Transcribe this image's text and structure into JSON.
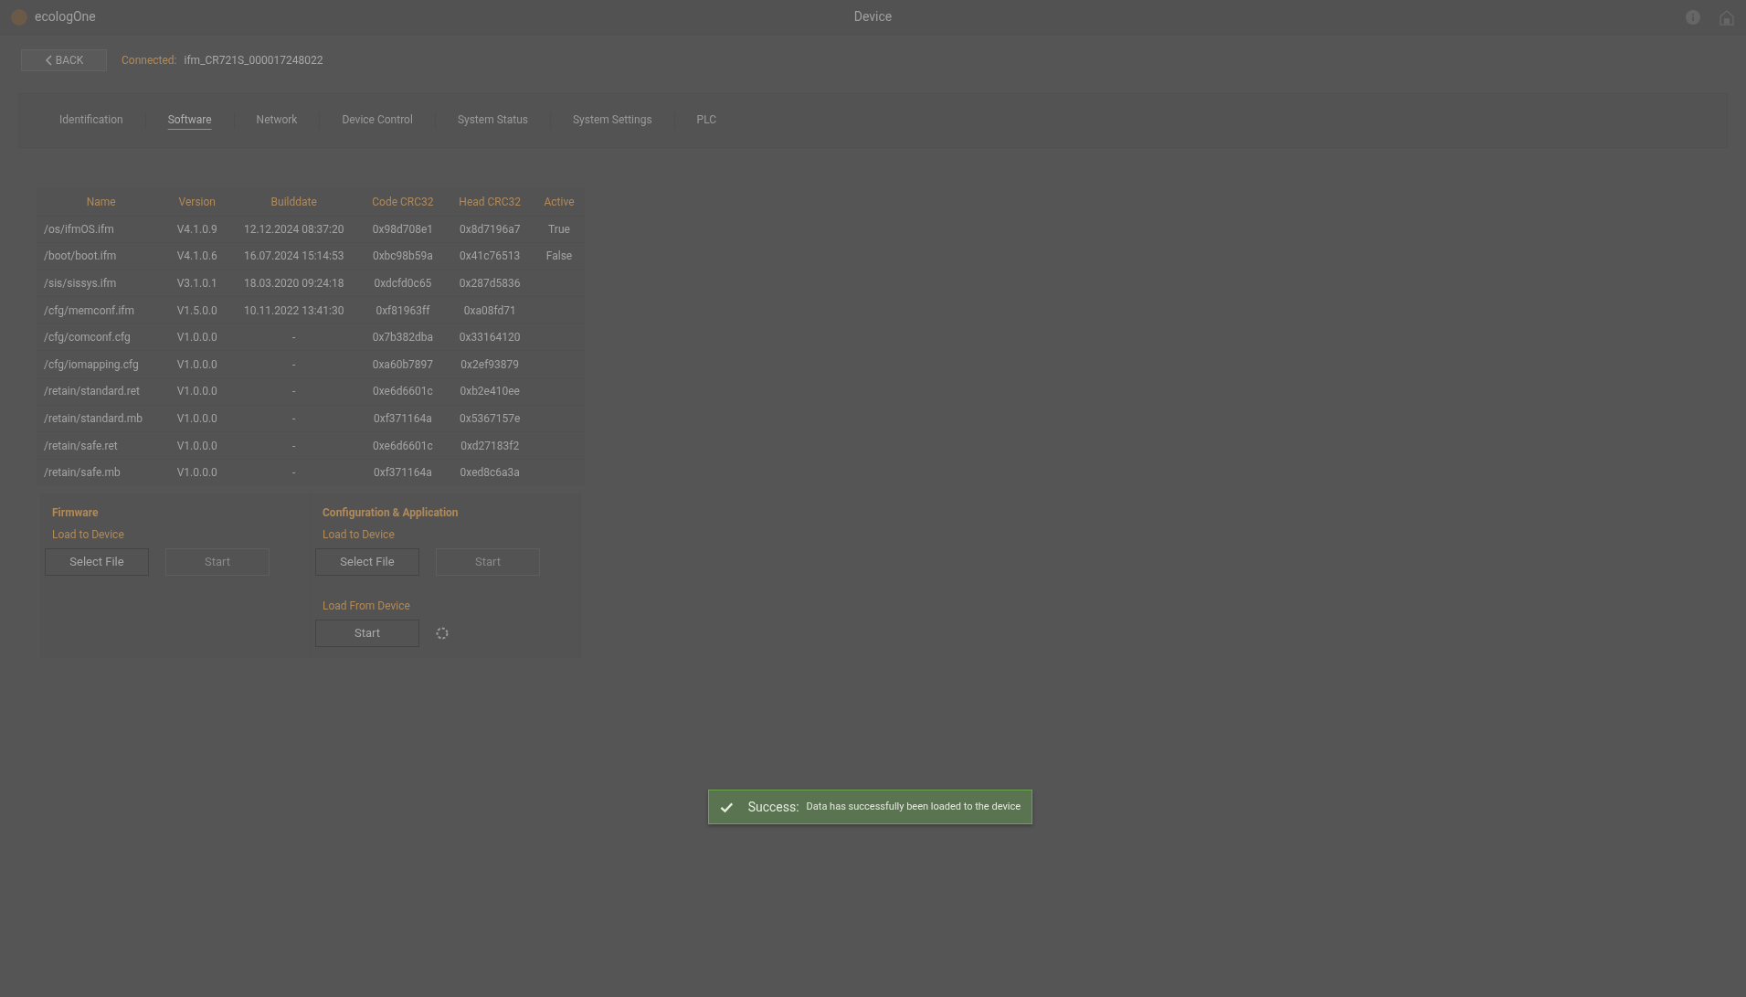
{
  "app": {
    "name": "ecologOne",
    "title": "Device"
  },
  "connection": {
    "back": "BACK",
    "label": "Connected:",
    "device": "ifm_CR721S_000017248022"
  },
  "tabs": [
    {
      "label": "Identification",
      "selected": false
    },
    {
      "label": "Software",
      "selected": true
    },
    {
      "label": "Network",
      "selected": false
    },
    {
      "label": "Device Control",
      "selected": false
    },
    {
      "label": "System Status",
      "selected": false
    },
    {
      "label": "System Settings",
      "selected": false
    },
    {
      "label": "PLC",
      "selected": false
    }
  ],
  "table": {
    "columns": [
      "Name",
      "Version",
      "Builddate",
      "Code CRC32",
      "Head CRC32",
      "Active"
    ],
    "rows": [
      [
        "/os/ifmOS.ifm",
        "V4.1.0.9",
        "12.12.2024 08:37:20",
        "0x98d708e1",
        "0x8d7196a7",
        "True"
      ],
      [
        "/boot/boot.ifm",
        "V4.1.0.6",
        "16.07.2024 15:14:53",
        "0xbc98b59a",
        "0x41c76513",
        "False"
      ],
      [
        "/sis/sissys.ifm",
        "V3.1.0.1",
        "18.03.2020 09:24:18",
        "0xdcfd0c65",
        "0x287d5836",
        ""
      ],
      [
        "/cfg/memconf.ifm",
        "V1.5.0.0",
        "10.11.2022 13:41:30",
        "0xf81963ff",
        "0xa08fd71",
        ""
      ],
      [
        "/cfg/comconf.cfg",
        "V1.0.0.0",
        "-",
        "0x7b382dba",
        "0x33164120",
        ""
      ],
      [
        "/cfg/iomapping.cfg",
        "V1.0.0.0",
        "-",
        "0xa60b7897",
        "0x2ef93879",
        ""
      ],
      [
        "/retain/standard.ret",
        "V1.0.0.0",
        "-",
        "0xe6d6601c",
        "0xb2e410ee",
        ""
      ],
      [
        "/retain/standard.mb",
        "V1.0.0.0",
        "-",
        "0xf371164a",
        "0x5367157e",
        ""
      ],
      [
        "/retain/safe.ret",
        "V1.0.0.0",
        "-",
        "0xe6d6601c",
        "0xd27183f2",
        ""
      ],
      [
        "/retain/safe.mb",
        "V1.0.0.0",
        "-",
        "0xf371164a",
        "0xed8c6a3a",
        ""
      ]
    ]
  },
  "panels": [
    {
      "title": "Firmware",
      "sections": [
        {
          "heading": "Load to Device",
          "buttons": [
            {
              "label": "Select File",
              "disabled": false
            },
            {
              "label": "Start",
              "disabled": true
            }
          ]
        }
      ]
    },
    {
      "title": "Configuration & Application",
      "sections": [
        {
          "heading": "Load to Device",
          "buttons": [
            {
              "label": "Select File",
              "disabled": false
            },
            {
              "label": "Start",
              "disabled": true
            }
          ]
        },
        {
          "heading": "Load From Device",
          "buttons": [
            {
              "label": "Start",
              "disabled": false
            }
          ],
          "busy": true
        }
      ]
    }
  ],
  "toast": {
    "kind": "success",
    "title": "Success:",
    "message": "Data has successfully been loaded to the device"
  }
}
